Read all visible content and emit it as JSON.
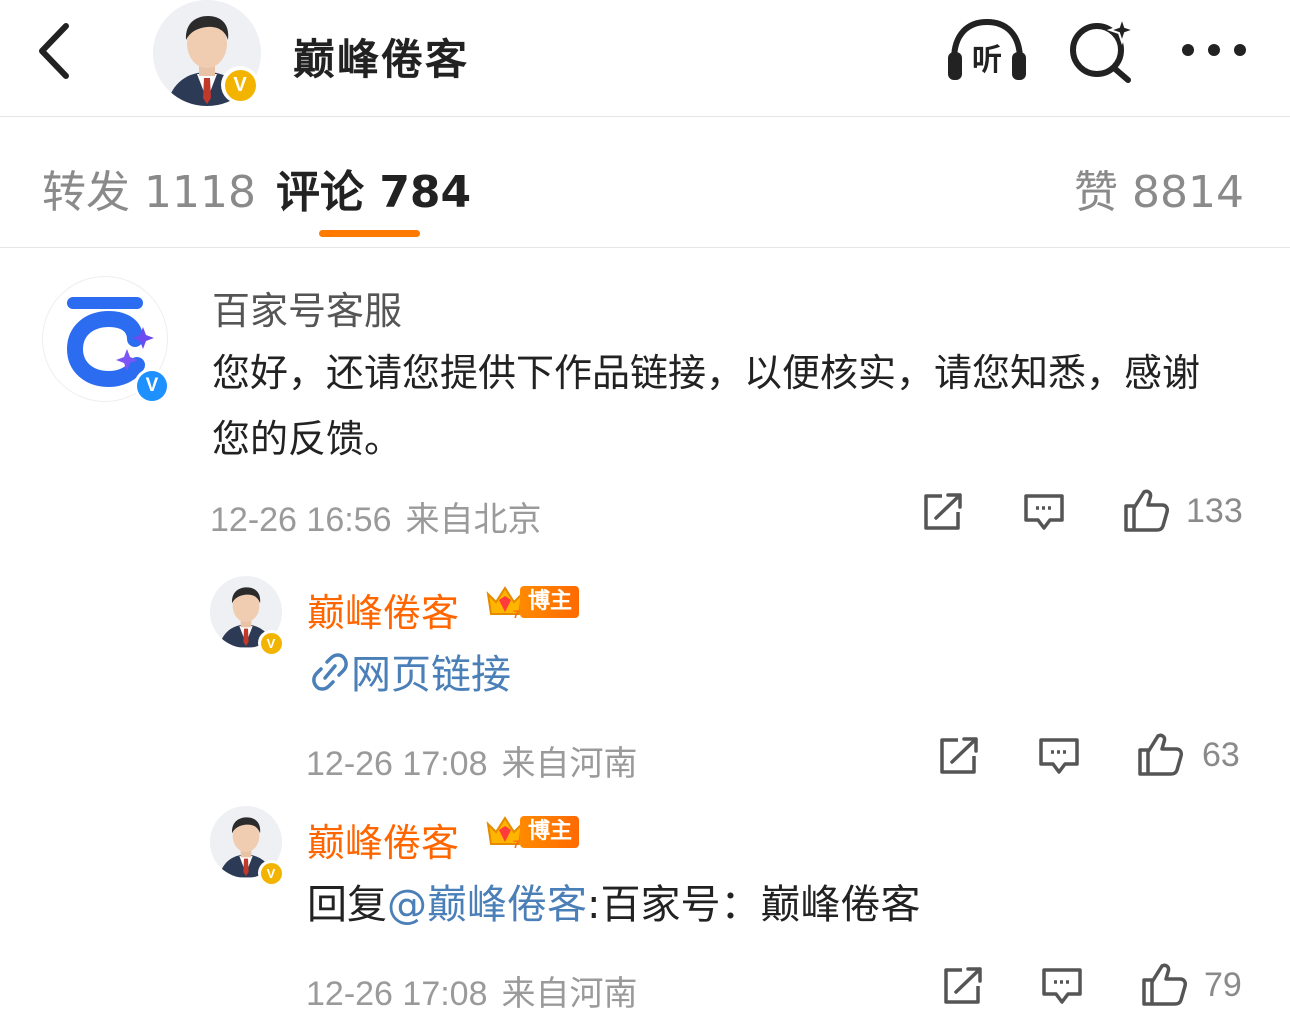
{
  "header": {
    "title": "巅峰倦客",
    "listen_label": "听"
  },
  "tabs": {
    "reposts": "转发 1118",
    "comments": "评论 784",
    "likes": "赞 8814"
  },
  "comments": [
    {
      "author": "百家号客服",
      "text": "您好，还请您提供下作品链接，以便核实，请您知悉，感谢您的反馈。",
      "time": "12-26 16:56",
      "location": "来自北京",
      "like_count": "133"
    },
    {
      "author": "巅峰倦客",
      "badge": "博主",
      "link_text": "网页链接",
      "time": "12-26 17:08",
      "location": "来自河南",
      "like_count": "63"
    },
    {
      "author": "巅峰倦客",
      "badge": "博主",
      "reply_prefix": "回复",
      "mention": "@巅峰倦客",
      "reply_rest": ":百家号：巅峰倦客",
      "time": "12-26 17:08",
      "location": "来自河南",
      "like_count": "79"
    }
  ],
  "colors": {
    "accent_orange": "#ff7a00",
    "blogger_name": "#ff6600",
    "link_blue": "#4a7fb8",
    "verified_gold": "#f3b400",
    "verified_blue": "#1e90ff"
  }
}
